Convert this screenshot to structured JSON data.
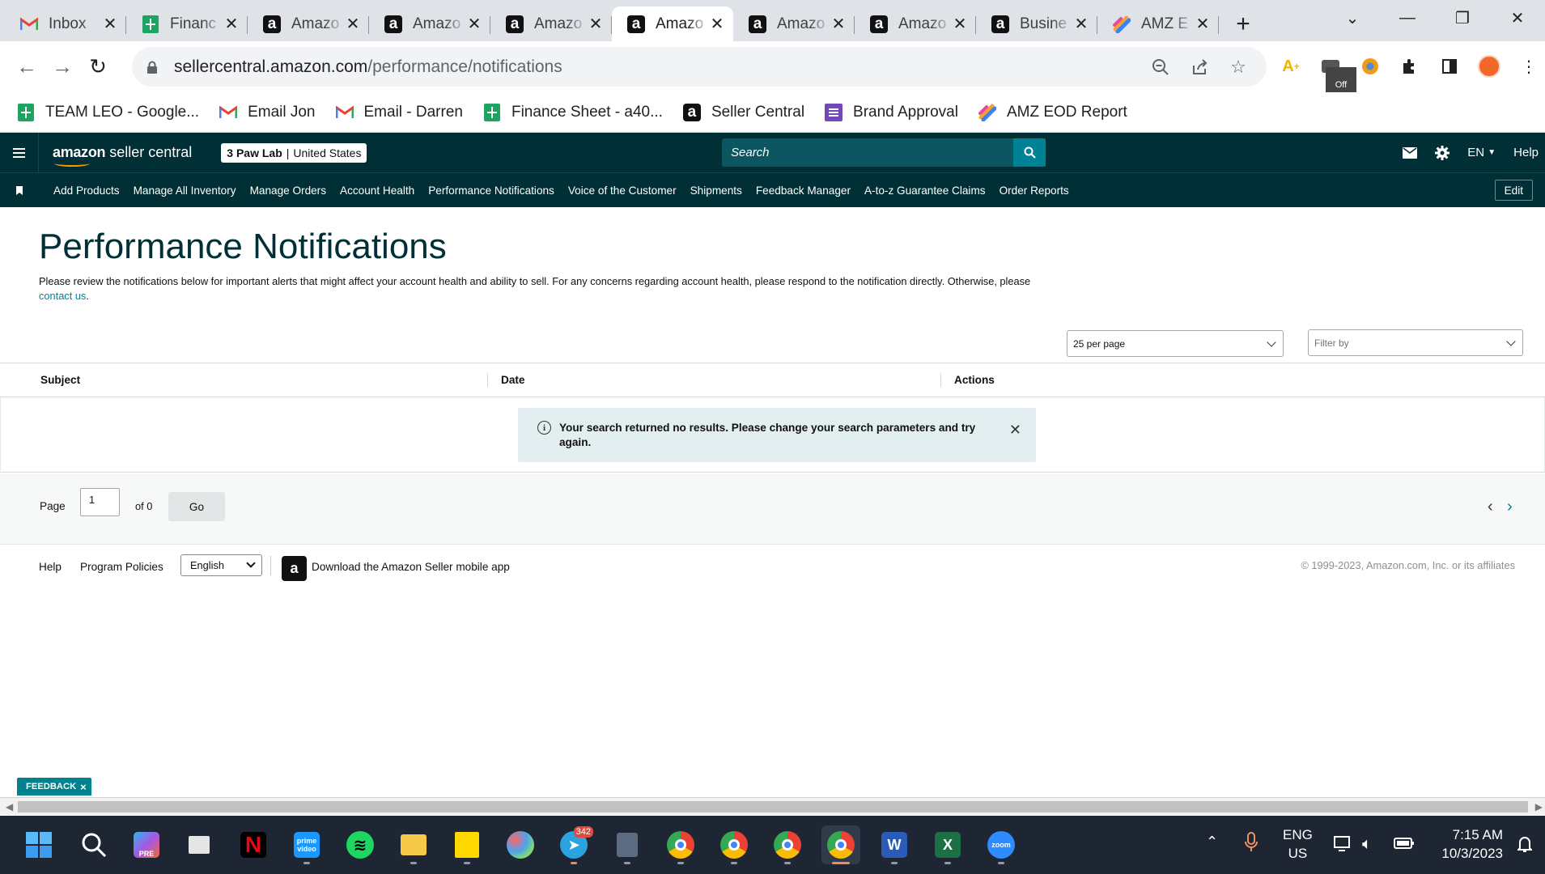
{
  "browser": {
    "tabs": [
      {
        "title": "Inbox",
        "icon": "gmail-icon"
      },
      {
        "title": "Financ",
        "icon": "sheets-icon"
      },
      {
        "title": "Amazo",
        "icon": "amazon-icon"
      },
      {
        "title": "Amazo",
        "icon": "amazon-icon"
      },
      {
        "title": "Amazo",
        "icon": "amazon-icon"
      },
      {
        "title": "Amazo",
        "icon": "amazon-icon",
        "active": true
      },
      {
        "title": "Amazo",
        "icon": "amazon-icon"
      },
      {
        "title": "Amazo",
        "icon": "amazon-icon"
      },
      {
        "title": "Busine",
        "icon": "amazon-icon"
      },
      {
        "title": "AMZ E",
        "icon": "clickup-icon"
      }
    ],
    "url_host": "sellercentral.amazon.com",
    "url_path": "/performance/notifications",
    "bookmarks": [
      {
        "label": "TEAM LEO - Google...",
        "icon": "sheets-icon"
      },
      {
        "label": "Email Jon",
        "icon": "gmail-icon"
      },
      {
        "label": "Email - Darren",
        "icon": "gmail-icon"
      },
      {
        "label": "Finance Sheet - a40...",
        "icon": "sheets-icon"
      },
      {
        "label": "Seller Central",
        "icon": "amazon-icon"
      },
      {
        "label": "Brand Approval",
        "icon": "forms-icon"
      },
      {
        "label": "AMZ EOD Report",
        "icon": "clickup-icon"
      }
    ],
    "extension_badge": "Off"
  },
  "header": {
    "logo_text": "amazon seller central",
    "store_name": "3 Paw Lab",
    "marketplace": "United States",
    "search_placeholder": "Search",
    "language": "EN",
    "help": "Help"
  },
  "nav": {
    "items": [
      "Add Products",
      "Manage All Inventory",
      "Manage Orders",
      "Account Health",
      "Performance Notifications",
      "Voice of the Customer",
      "Shipments",
      "Feedback Manager",
      "A-to-z Guarantee Claims",
      "Order Reports"
    ],
    "edit": "Edit"
  },
  "page": {
    "title": "Performance Notifications",
    "intro": "Please review the notifications below for important alerts that might affect your account health and ability to sell. For any concerns regarding account health, please respond to the notification directly. Otherwise, please ",
    "intro_link": "contact us",
    "intro_end": ".",
    "per_page": "25 per page",
    "filter_placeholder": "Filter by",
    "columns": [
      "Subject",
      "Date",
      "Actions"
    ],
    "alert_message": "Your search returned no results. Please change your search parameters and try again.",
    "pager": {
      "page_label": "Page",
      "page_value": "1",
      "of_label": "of 0",
      "go": "Go"
    }
  },
  "footer": {
    "help": "Help",
    "program_policies": "Program Policies",
    "language": "English",
    "download_app": "Download the Amazon Seller mobile app",
    "copyright": "© 1999-2023, Amazon.com, Inc. or its affiliates"
  },
  "feedback": "FEEDBACK",
  "taskbar": {
    "telegram_badge": "342",
    "zoom_label": "zoom",
    "prime_label": "prime video",
    "lang_line1": "ENG",
    "lang_line2": "US",
    "time": "7:15 AM",
    "date": "10/3/2023"
  }
}
